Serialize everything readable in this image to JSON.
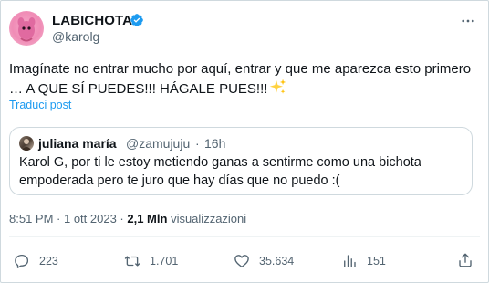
{
  "author": {
    "display_name": "LABICHOTA",
    "handle": "@karolg",
    "verified": true,
    "avatar_color": "#f08cb6"
  },
  "tweet": {
    "text": "Imagínate no entrar mucho por aquí, entrar y que me aparezca esto primero …   A QUE SÍ PUEDES!!!  HÁGALE PUES!!!",
    "emoji": "sparkles-icon",
    "translate_label": "Traduci post"
  },
  "quote": {
    "name": "juliana maría",
    "handle": "@zamujuju",
    "separator": "·",
    "time": "16h",
    "text": "Karol G, por ti le estoy metiendo ganas a sentirme como una bichota empoderada pero te juro que hay días que no puedo :("
  },
  "meta": {
    "time": "8:51 PM",
    "sep1": " · ",
    "date": "1 ott 2023",
    "sep2": " · ",
    "views": "2,1 Mln",
    "views_label": " visualizzazioni"
  },
  "actions": {
    "replies": "223",
    "retweets": "1.701",
    "likes": "35.634",
    "bookmarks": "151"
  },
  "colors": {
    "text": "#0f1419",
    "secondary": "#536471",
    "link": "#1d9bf0",
    "border": "#cfd9de",
    "verified": "#1d9bf0"
  }
}
